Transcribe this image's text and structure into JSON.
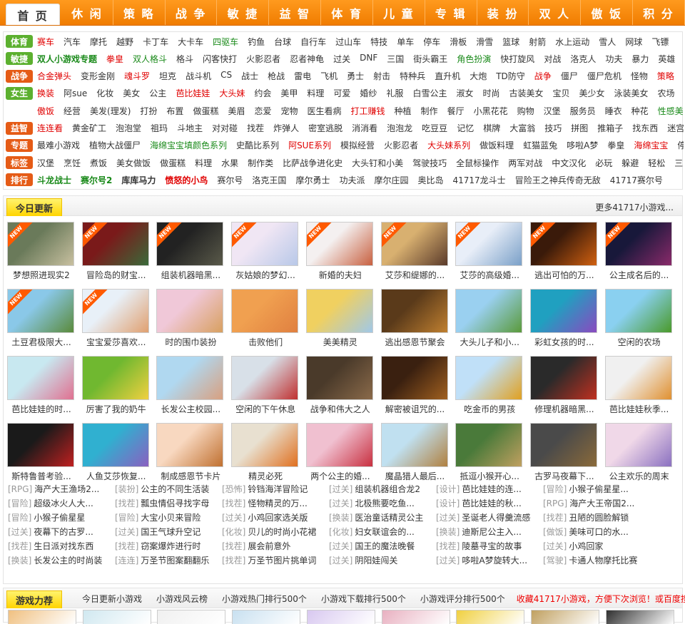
{
  "nav": [
    "首 页",
    "休 闲",
    "策 略",
    "战 争",
    "敏 捷",
    "益 智",
    "体 育",
    "儿 童",
    "专 辑",
    "装 扮",
    "双 人",
    "傲 饭",
    "积 分"
  ],
  "categories": [
    {
      "tag": "体育",
      "color": "#5cb02f",
      "items": [
        {
          "t": "赛车",
          "c": "#e00000"
        },
        {
          "t": "汽车"
        },
        {
          "t": "摩托"
        },
        {
          "t": "越野"
        },
        {
          "t": "卡丁车"
        },
        {
          "t": "大卡车"
        },
        {
          "t": "四驱车",
          "c": "#1a8a1a"
        },
        {
          "t": "钓鱼"
        },
        {
          "t": "台球"
        },
        {
          "t": "自行车"
        },
        {
          "t": "过山车"
        },
        {
          "t": "特技"
        },
        {
          "t": "单车"
        },
        {
          "t": "停车"
        },
        {
          "t": "滑板"
        },
        {
          "t": "滑雪"
        },
        {
          "t": "篮球"
        },
        {
          "t": "射箭"
        },
        {
          "t": "水上运动"
        },
        {
          "t": "雪人"
        },
        {
          "t": "网球"
        },
        {
          "t": "飞镖"
        }
      ]
    },
    {
      "tag": "敏捷",
      "color": "#5cb02f",
      "items": [
        {
          "t": "双人小游戏专题",
          "c": "#1a8a1a",
          "b": 1
        },
        {
          "t": "拳皇",
          "c": "#e00000"
        },
        {
          "t": "双人格斗",
          "c": "#1a8a1a"
        },
        {
          "t": "格斗"
        },
        {
          "t": "闪客快打"
        },
        {
          "t": "火影忍者"
        },
        {
          "t": "忍者神龟"
        },
        {
          "t": "过关"
        },
        {
          "t": "DNF"
        },
        {
          "t": "三国"
        },
        {
          "t": "街头霸王"
        },
        {
          "t": "角色扮演",
          "c": "#1a8a1a"
        },
        {
          "t": "快打旋风"
        },
        {
          "t": "对战"
        },
        {
          "t": "洛克人"
        },
        {
          "t": "功夫"
        },
        {
          "t": "暴力"
        },
        {
          "t": "英雄"
        },
        {
          "t": "死神"
        }
      ]
    },
    {
      "tag": "战争",
      "color": "#e55b16",
      "items": [
        {
          "t": "合金弹头",
          "c": "#e00000"
        },
        {
          "t": "变形金刚"
        },
        {
          "t": "魂斗罗",
          "c": "#e00000"
        },
        {
          "t": "坦克"
        },
        {
          "t": "战斗机"
        },
        {
          "t": "CS"
        },
        {
          "t": "战士"
        },
        {
          "t": "枪战"
        },
        {
          "t": "雷电"
        },
        {
          "t": "飞机"
        },
        {
          "t": "勇士"
        },
        {
          "t": "射击"
        },
        {
          "t": "特种兵"
        },
        {
          "t": "直升机"
        },
        {
          "t": "大炮"
        },
        {
          "t": "TD防守"
        },
        {
          "t": "战争",
          "c": "#e00000"
        },
        {
          "t": "僵尸"
        },
        {
          "t": "僵尸危机"
        },
        {
          "t": "怪物"
        },
        {
          "t": "策略",
          "c": "#e00000"
        }
      ]
    },
    {
      "tag": "女生",
      "color": "#5cb02f",
      "items": [
        {
          "t": "换装",
          "c": "#e00000"
        },
        {
          "t": "阿sue"
        },
        {
          "t": "化妆"
        },
        {
          "t": "美女"
        },
        {
          "t": "公主"
        },
        {
          "t": "芭比娃娃",
          "c": "#e00000"
        },
        {
          "t": "大头妹",
          "c": "#e00000"
        },
        {
          "t": "约会"
        },
        {
          "t": "美甲"
        },
        {
          "t": "料理"
        },
        {
          "t": "可爱"
        },
        {
          "t": "婚纱"
        },
        {
          "t": "礼服"
        },
        {
          "t": "白雪公主"
        },
        {
          "t": "淑女"
        },
        {
          "t": "时尚"
        },
        {
          "t": "古装美女"
        },
        {
          "t": "宝贝"
        },
        {
          "t": "美少女"
        },
        {
          "t": "泳装美女"
        },
        {
          "t": "农场"
        },
        {
          "t": "MM",
          "c": "#e00000"
        }
      ]
    },
    {
      "tag": "",
      "color": "",
      "items": [
        {
          "t": "傲饭",
          "c": "#e00000"
        },
        {
          "t": "经营"
        },
        {
          "t": "美发(理发)"
        },
        {
          "t": "打扮"
        },
        {
          "t": "布置"
        },
        {
          "t": "做蛋糕"
        },
        {
          "t": "美眉"
        },
        {
          "t": "恋爱"
        },
        {
          "t": "宠物"
        },
        {
          "t": "医生看病"
        },
        {
          "t": "打工赚钱",
          "c": "#e00000"
        },
        {
          "t": "种植"
        },
        {
          "t": "制作"
        },
        {
          "t": "餐厅"
        },
        {
          "t": "小黑花花"
        },
        {
          "t": "购物"
        },
        {
          "t": "汉堡"
        },
        {
          "t": "服务员"
        },
        {
          "t": "睡衣"
        },
        {
          "t": "种花"
        },
        {
          "t": "性感美女",
          "c": "#1a8a1a"
        }
      ]
    },
    {
      "tag": "益智",
      "color": "#e55b16",
      "items": [
        {
          "t": "连连看",
          "c": "#e00000"
        },
        {
          "t": "黄金矿工"
        },
        {
          "t": "泡泡堂"
        },
        {
          "t": "祖玛"
        },
        {
          "t": "斗地主"
        },
        {
          "t": "对对碰"
        },
        {
          "t": "找茬"
        },
        {
          "t": "炸弹人"
        },
        {
          "t": "密室逃脱"
        },
        {
          "t": "消消看"
        },
        {
          "t": "泡泡龙"
        },
        {
          "t": "吃豆豆"
        },
        {
          "t": "记忆"
        },
        {
          "t": "棋牌"
        },
        {
          "t": "大富翁"
        },
        {
          "t": "技巧"
        },
        {
          "t": "拼图"
        },
        {
          "t": "推箱子"
        },
        {
          "t": "找东西"
        },
        {
          "t": "迷宫"
        }
      ]
    },
    {
      "tag": "专题",
      "color": "#e55b16",
      "items": [
        {
          "t": "最难小游戏"
        },
        {
          "t": "植物大战僵尸"
        },
        {
          "t": "海绵宝宝填颜色系列",
          "c": "#1a8a1a"
        },
        {
          "t": "史酷比系列"
        },
        {
          "t": "阿SUE系列",
          "c": "#e00000"
        },
        {
          "t": "模拟经营"
        },
        {
          "t": "火影忍者"
        },
        {
          "t": "大头妹系列",
          "c": "#e00000"
        },
        {
          "t": "做饭料理"
        },
        {
          "t": "虹猫蓝兔"
        },
        {
          "t": "哆啦A梦"
        },
        {
          "t": "拳皇"
        },
        {
          "t": "海绵宝宝",
          "c": "#e00000"
        },
        {
          "t": "停车"
        }
      ]
    },
    {
      "tag": "标签",
      "color": "#e55b16",
      "items": [
        {
          "t": "汉堡"
        },
        {
          "t": "烹饪"
        },
        {
          "t": "煮饭"
        },
        {
          "t": "美女做饭"
        },
        {
          "t": "做蛋糕"
        },
        {
          "t": "料理"
        },
        {
          "t": "水果"
        },
        {
          "t": "制作类"
        },
        {
          "t": "比萨战争进化史"
        },
        {
          "t": "大头钉和小美"
        },
        {
          "t": "驾驶技巧"
        },
        {
          "t": "全鼠标操作"
        },
        {
          "t": "两军对战"
        },
        {
          "t": "中文汉化"
        },
        {
          "t": "必玩"
        },
        {
          "t": "躲避"
        },
        {
          "t": "轻松"
        },
        {
          "t": "三明治"
        }
      ]
    },
    {
      "tag": "排行",
      "color": "#e55b16",
      "items": [
        {
          "t": "斗龙战士",
          "c": "#1a8a1a",
          "b": 1
        },
        {
          "t": "赛尔号2",
          "c": "#1a8a1a",
          "b": 1
        },
        {
          "t": "库库马力",
          "c": "#333",
          "b": 1
        },
        {
          "t": "愤怒的小鸟",
          "c": "#e00000",
          "b": 1
        },
        {
          "t": "赛尔号"
        },
        {
          "t": "洛克王国"
        },
        {
          "t": "摩尔勇士"
        },
        {
          "t": "功夫派"
        },
        {
          "t": "摩尔庄园"
        },
        {
          "t": "奥比岛"
        },
        {
          "t": "41717龙斗士"
        },
        {
          "t": "冒险王之神兵传奇无敌"
        },
        {
          "t": "41717赛尔号"
        }
      ]
    }
  ],
  "today": {
    "title": "今日更新",
    "more": "更多41717小游戏...",
    "games": [
      {
        "t": "梦想照进现实2",
        "n": 1,
        "c1": "#6a7a5a",
        "c2": "#c8c0a0"
      },
      {
        "t": "冒险岛的财宝...",
        "n": 1,
        "c1": "#7a1a1a",
        "c2": "#3a6a3a"
      },
      {
        "t": "组装机器暗黑...",
        "n": 1,
        "c1": "#222",
        "c2": "#5a5a4a"
      },
      {
        "t": "灰姑娘的梦幻...",
        "n": 1,
        "c1": "#f0e6f4",
        "c2": "#b8c8e8"
      },
      {
        "t": "新婚的夫妇",
        "n": 1,
        "c1": "#f4f0f0",
        "c2": "#c86040"
      },
      {
        "t": "艾莎和缇娜的...",
        "n": 1,
        "c1": "#d8b070",
        "c2": "#5a3a2a"
      },
      {
        "t": "艾莎的高级婚...",
        "n": 1,
        "c1": "#e8eef8",
        "c2": "#7aa0c8"
      },
      {
        "t": "逃出可怕的万...",
        "n": 1,
        "c1": "#3a1a0a",
        "c2": "#d06010"
      },
      {
        "t": "公主成名后的...",
        "n": 1,
        "c1": "#18183a",
        "c2": "#8a2a6a"
      },
      {
        "t": "土豆君极限大...",
        "n": 1,
        "c1": "#8ac8e8",
        "c2": "#5a8a3a"
      },
      {
        "t": "宝宝爱莎喜欢...",
        "n": 1,
        "c1": "#e8f0f8",
        "c2": "#e0a070"
      },
      {
        "t": "时的围巾装扮",
        "n": 0,
        "c1": "#f0c8d8",
        "c2": "#d8a060"
      },
      {
        "t": "击败他们",
        "n": 0,
        "c1": "#f0a050",
        "c2": "#e08040"
      },
      {
        "t": "美美精灵",
        "n": 0,
        "c1": "#f0d060",
        "c2": "#a0c8e8"
      },
      {
        "t": "逃出感恩节聚会",
        "n": 0,
        "c1": "#5a3a1a",
        "c2": "#c08030"
      },
      {
        "t": "大头儿子和小...",
        "n": 0,
        "c1": "#9ad0f0",
        "c2": "#5a9a3a"
      },
      {
        "t": "彩虹女孩的时...",
        "n": 0,
        "c1": "#20a0c0",
        "c2": "#8a4ac0"
      },
      {
        "t": "空闲的农场",
        "n": 0,
        "c1": "#8ad0f0",
        "c2": "#4a9a2a"
      },
      {
        "t": "芭比娃娃的时...",
        "n": 0,
        "c1": "#c8e8f0",
        "c2": "#e07090"
      },
      {
        "t": "厉害了我的奶牛",
        "n": 0,
        "c1": "#70b830",
        "c2": "#f0d040"
      },
      {
        "t": "长发公主校园...",
        "n": 0,
        "c1": "#b0d8f0",
        "c2": "#d8a080"
      },
      {
        "t": "空闲的下午休息",
        "n": 0,
        "c1": "#d8e0e8",
        "c2": "#c03030"
      },
      {
        "t": "战争和伟大之人",
        "n": 0,
        "c1": "#4a3a2a",
        "c2": "#8a6a4a"
      },
      {
        "t": "解密被诅咒的...",
        "n": 0,
        "c1": "#3a2010",
        "c2": "#a06020"
      },
      {
        "t": "吃金币的男孩",
        "n": 0,
        "c1": "#c0e0f8",
        "c2": "#e0a020"
      },
      {
        "t": "修理机器暗黑...",
        "n": 0,
        "c1": "#2a2a2a",
        "c2": "#c03020"
      },
      {
        "t": "芭比娃娃秋季...",
        "n": 0,
        "c1": "#f0f0f0",
        "c2": "#e09030"
      },
      {
        "t": "斯特鲁普考验...",
        "n": 0,
        "c1": "#1a1a1a",
        "c2": "#c02020"
      },
      {
        "t": "人鱼艾莎恢复...",
        "n": 0,
        "c1": "#30b0d0",
        "c2": "#8a60c0"
      },
      {
        "t": "制成感恩节卡片",
        "n": 0,
        "c1": "#f8d8c0",
        "c2": "#c07030"
      },
      {
        "t": "精灵必死",
        "n": 0,
        "c1": "#e8e0d0",
        "c2": "#e07020"
      },
      {
        "t": "两个公主的婚...",
        "n": 0,
        "c1": "#f0c0d0",
        "c2": "#c83040"
      },
      {
        "t": "魔晶猎人最后...",
        "n": 0,
        "c1": "#c0e0f0",
        "c2": "#b08040"
      },
      {
        "t": "抵逗小猴开心...",
        "n": 0,
        "c1": "#4a7a3a",
        "c2": "#c0a060"
      },
      {
        "t": "古罗马夜幕下...",
        "n": 0,
        "c1": "#4a4a4a",
        "c2": "#8a6a3a"
      },
      {
        "t": "公主欢乐的周末",
        "n": 0,
        "c1": "#f0d8e8",
        "c2": "#8a70c0"
      }
    ]
  },
  "lists": [
    [
      {
        "c": "[RPG]",
        "t": "海产大王渔场2..."
      },
      {
        "c": "[装扮]",
        "t": "公主的不同生活装"
      },
      {
        "c": "[恐怖]",
        "t": "铃铛海洋冒险记"
      },
      {
        "c": "[过关]",
        "t": "组装机器组合龙2"
      },
      {
        "c": "[设计]",
        "t": "芭比娃娃的连..."
      },
      {
        "c": "[冒险]",
        "t": "小猴子偷星星..."
      }
    ],
    [
      {
        "c": "[冒险]",
        "t": "超级冰火人大..."
      },
      {
        "c": "[找茬]",
        "t": "瓢虫情侣寻找字母"
      },
      {
        "c": "[找茬]",
        "t": "怪物精灵的万..."
      },
      {
        "c": "[过关]",
        "t": "北极熊要吃鱼..."
      },
      {
        "c": "[设计]",
        "t": "芭比娃娃的秋..."
      },
      {
        "c": "[RPG]",
        "t": "海产大王帝国2..."
      }
    ],
    [
      {
        "c": "[冒险]",
        "t": "小猴子偷星星"
      },
      {
        "c": "[冒险]",
        "t": "大宝小贝来冒险"
      },
      {
        "c": "[过关]",
        "t": "小鸡回家选关版"
      },
      {
        "c": "[换装]",
        "t": "医治童话精灵公主"
      },
      {
        "c": "[过关]",
        "t": "圣诞老人得羹流感"
      },
      {
        "c": "[找茬]",
        "t": "丑陋的圆脸解锁"
      }
    ],
    [
      {
        "c": "[过关]",
        "t": "夜幕下的古罗..."
      },
      {
        "c": "[过关]",
        "t": "国王气球升空记"
      },
      {
        "c": "[化妆]",
        "t": "贝儿的时尚小花裙"
      },
      {
        "c": "[化妆]",
        "t": "妇女联谊会的..."
      },
      {
        "c": "[换装]",
        "t": "迪斯尼公主入..."
      },
      {
        "c": "[做饭]",
        "t": "美味可口的水..."
      }
    ],
    [
      {
        "c": "[找茬]",
        "t": "生日派对找东西"
      },
      {
        "c": "[找茬]",
        "t": "窃案爆炸进行时"
      },
      {
        "c": "[找茬]",
        "t": "展会前意外"
      },
      {
        "c": "[过关]",
        "t": "国王的魔法晚餐"
      },
      {
        "c": "[找茬]",
        "t": "陵墓寻宝的故事"
      },
      {
        "c": "[过关]",
        "t": "小鸡回家"
      }
    ],
    [
      {
        "c": "[换装]",
        "t": "长发公主的时尚装"
      },
      {
        "c": "[连连]",
        "t": "万圣节图案翻翻乐"
      },
      {
        "c": "[找茬]",
        "t": "万圣节图片挑单词"
      },
      {
        "c": "[过关]",
        "t": "阴阳娃闯关"
      },
      {
        "c": "[过关]",
        "t": "哆啦A梦旋转大..."
      },
      {
        "c": "[驾驶]",
        "t": "卡通人物摩托比赛"
      }
    ]
  ],
  "recommend": {
    "title": "游戏力荐",
    "links": [
      "今日更新小游戏",
      "小游戏风云榜",
      "小游戏热门排行500个",
      "小游戏下载排行500个",
      "小游戏评分排行500个"
    ],
    "favorite": "收藏41717小游戏，方便下次浏览！或百度搜索"
  }
}
